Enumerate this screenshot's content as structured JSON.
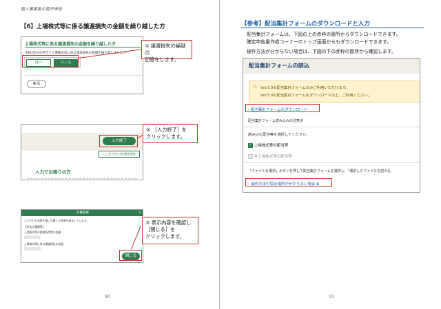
{
  "left": {
    "header": "個人事業者の電子申告",
    "section_title": "【6】上場株式等に係る譲渡損失の金額を繰り越した方",
    "shot1": {
      "title": "上場株式等に係る譲渡損失の金額を繰り越した方",
      "question": "令和3年分の申告で上場株式等に係る譲渡損失の金額を繰り越しましたか？",
      "yes": "はい",
      "no": "いいえ",
      "back": "戻る"
    },
    "callout1": {
      "num": "①",
      "text": "譲渡損失の繰越の\n回答をします。"
    },
    "shot2": {
      "finish": "入力終了",
      "link": "ここまでの入力内容を保存",
      "heading": "入力でお困りの方"
    },
    "callout2": {
      "num": "②",
      "text": "［入力終了］を\nクリックします。"
    },
    "shot3": {
      "header": "計算結果",
      "l1": "入力された内容を基に計算した結果を表示しています。",
      "l2": "【申告の種類等】",
      "l3": "上場株式等の譲渡所得等の金額",
      "l4": "上場株式等に係る譲渡損失の金額",
      "close": "閉じる"
    },
    "callout3": {
      "num": "③",
      "text": "表示内容を確認し\n［閉じる］を\nクリックします。"
    },
    "page_number": "90"
  },
  "right": {
    "title": "【参考】配当集計フォームのダウンロードと入力",
    "p1": "配当集計フォームは、下図の上の赤枠の箇所からダウンロードできます。",
    "p2": "確定申告書作成コーナーのトップ画面からもダウンロードできます。",
    "p3": "操作方法が分からない場合は、下図の下の赤枠の箇所から確認します。",
    "panel": {
      "title": "配当集計フォームの読込",
      "warn1": "Ver.5.0の配当集計フォームのみご利用いただけます。",
      "warn2": "Ver.5.0の配当集計フォームをダウンロードの上、ご利用ください。",
      "download": "配当集計フォームのダウンロード",
      "note": "配当集計フォーム読み込みの注意点",
      "select": "読み込む配当等を選択してください。",
      "cb1": "上場株式等の配当等",
      "cb2": "非上場株式等の配当等",
      "instr": "「ファイルを選択」ボタンを押して配当集計フォームを選択し、「選択したファイルを読み込",
      "help": "操作方法や保存場所が分からない場合"
    },
    "page_number": "91"
  },
  "colors": {
    "accent_red": "#d03030",
    "brand_green": "#2e7d4f",
    "title_blue": "#1a5fa8"
  }
}
